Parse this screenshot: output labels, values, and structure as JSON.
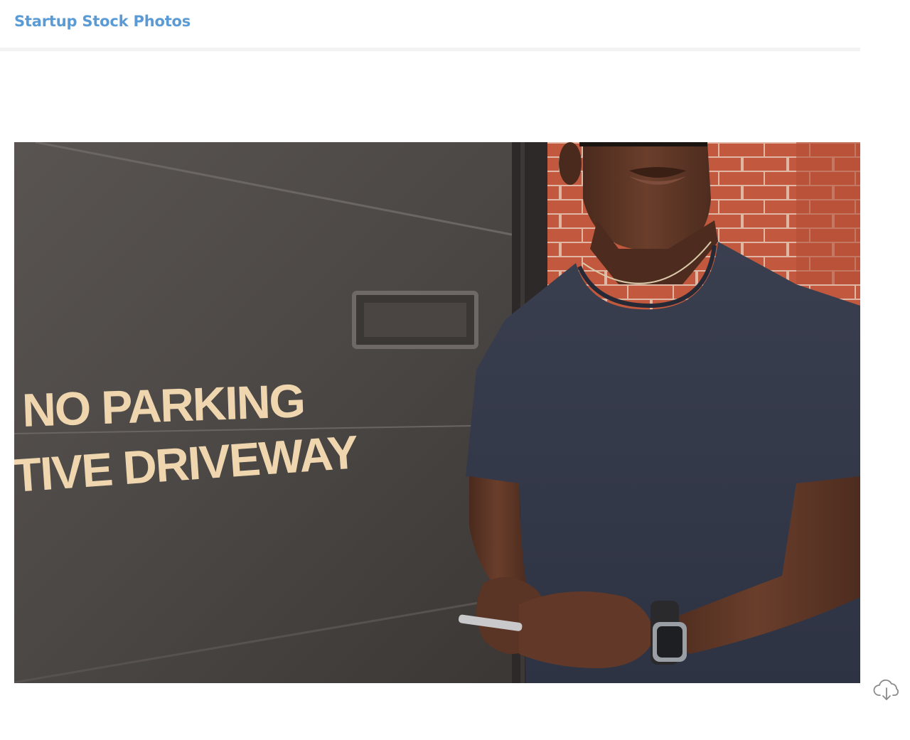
{
  "header": {
    "brand": "Startup Stock Photos"
  },
  "photo": {
    "sign_line_1": "NO PARKING",
    "sign_line_2": "TIVE DRIVEWAY"
  },
  "actions": {
    "download_icon": "cloud-download-icon"
  },
  "colors": {
    "brand": "#5b9bd5",
    "door": "#4a4644",
    "brick": "#c1553a",
    "shirt": "#34394a",
    "skin": "#5a3424",
    "sign_text": "#efd6ae"
  }
}
